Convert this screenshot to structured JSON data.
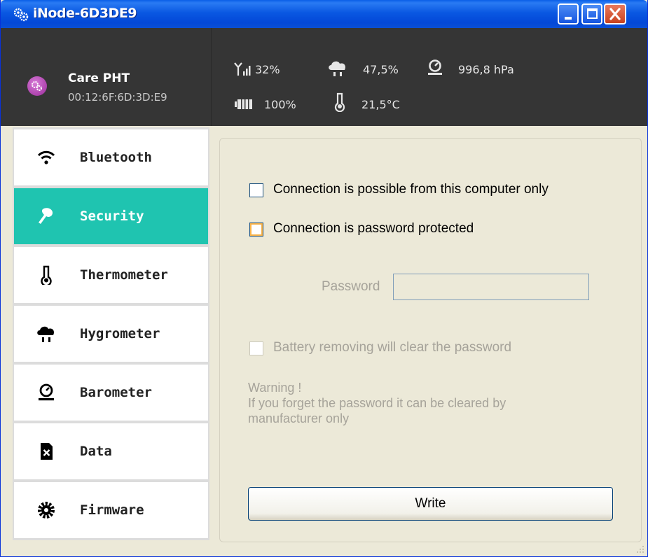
{
  "window": {
    "title": "iNode-6D3DE9"
  },
  "device": {
    "name": "Care PHT",
    "mac": "00:12:6F:6D:3D:E9"
  },
  "stats": {
    "signal": "32%",
    "humidity": "47,5%",
    "pressure": "996,8 hPa",
    "battery": "100%",
    "temperature": "21,5°C"
  },
  "sidebar": {
    "items": [
      {
        "label": "Bluetooth",
        "icon": "wifi-icon"
      },
      {
        "label": "Security",
        "icon": "key-icon",
        "active": true
      },
      {
        "label": "Thermometer",
        "icon": "thermometer-icon"
      },
      {
        "label": "Hygrometer",
        "icon": "rain-cloud-icon"
      },
      {
        "label": "Barometer",
        "icon": "barometer-icon"
      },
      {
        "label": "Data",
        "icon": "sd-card-icon"
      },
      {
        "label": "Firmware",
        "icon": "gear-icon"
      }
    ]
  },
  "security": {
    "option_local_only": "Connection is possible from this computer only",
    "option_password": "Connection is password protected",
    "password_label": "Password",
    "password_value": "",
    "option_battery_clear": "Battery removing will clear the password",
    "warning_title": "Warning !",
    "warning_text": "If you forget the password it can be cleared by manufacturer only",
    "write_label": "Write"
  },
  "colors": {
    "accent": "#1fc4b0",
    "header_bg": "#353535",
    "titlebar": "#0a58e2"
  }
}
